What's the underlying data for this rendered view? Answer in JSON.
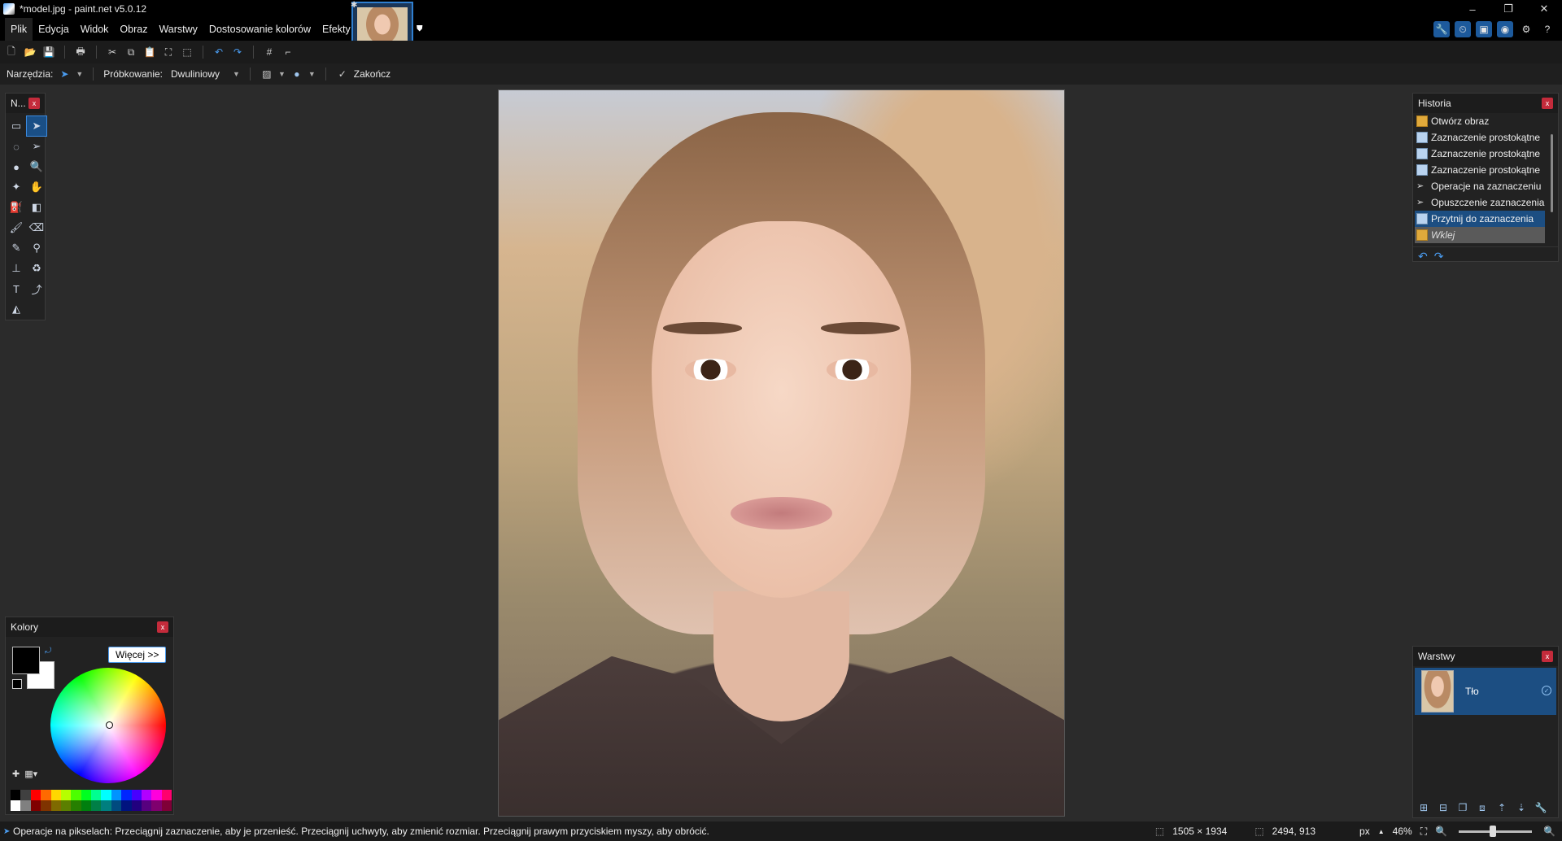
{
  "window": {
    "title": "*model.jpg - paint.net v5.0.12",
    "controls": [
      "–",
      "❐",
      "✕"
    ]
  },
  "menu": [
    "Plik",
    "Edycja",
    "Widok",
    "Obraz",
    "Warstwy",
    "Dostosowanie kolorów",
    "Efekty"
  ],
  "options_bar": {
    "tools_label": "Narzędzia:",
    "sampling_label": "Próbkowanie:",
    "sampling_value": "Dwuliniowy",
    "finish_label": "Zakończ"
  },
  "tools_panel": {
    "title": "N...",
    "close": "x"
  },
  "history_panel": {
    "title": "Historia",
    "close": "x",
    "items": [
      {
        "label": "Otwórz obraz",
        "icon": "folder-icon"
      },
      {
        "label": "Zaznaczenie prostokątne",
        "icon": "rect-select-icon"
      },
      {
        "label": "Zaznaczenie prostokątne",
        "icon": "rect-select-icon"
      },
      {
        "label": "Zaznaczenie prostokątne",
        "icon": "rect-select-icon"
      },
      {
        "label": "Operacje na zaznaczeniu",
        "icon": "move-selection-icon"
      },
      {
        "label": "Opuszczenie zaznaczenia",
        "icon": "move-selection-icon"
      },
      {
        "label": "Przytnij do zaznaczenia",
        "icon": "crop-icon",
        "state": "selected"
      },
      {
        "label": "Wklej",
        "icon": "paste-icon",
        "state": "undone"
      }
    ]
  },
  "colors_panel": {
    "title": "Kolory",
    "close": "x",
    "more_button": "Więcej >>",
    "primary_color": "#000000",
    "secondary_color": "#ffffff",
    "palette": [
      "#000000",
      "#404040",
      "#ff0000",
      "#ff6a00",
      "#ffd800",
      "#b6ff00",
      "#4cff00",
      "#00ff21",
      "#00ff90",
      "#00ffff",
      "#0094ff",
      "#0026ff",
      "#4800ff",
      "#b200ff",
      "#ff00dc",
      "#ff006e",
      "#ffffff",
      "#808080",
      "#7f0000",
      "#7f3300",
      "#7f6a00",
      "#5b7f00",
      "#267f00",
      "#007f0e",
      "#007f46",
      "#007f7f",
      "#004a7f",
      "#00137f",
      "#21007f",
      "#57007f",
      "#7f006e",
      "#7f0037"
    ]
  },
  "layers_panel": {
    "title": "Warstwy",
    "close": "x",
    "layers": [
      {
        "name": "Tło",
        "visible": true
      }
    ]
  },
  "status": {
    "hint": "Operacje na pikselach: Przeciągnij zaznaczenie, aby je przenieść. Przeciągnij uchwyty, aby zmienić rozmiar. Przeciągnij prawym przyciskiem myszy, aby obrócić.",
    "selection_size": "1505 × 1934",
    "cursor_position": "2494, 913",
    "units": "px",
    "zoom": "46%"
  }
}
